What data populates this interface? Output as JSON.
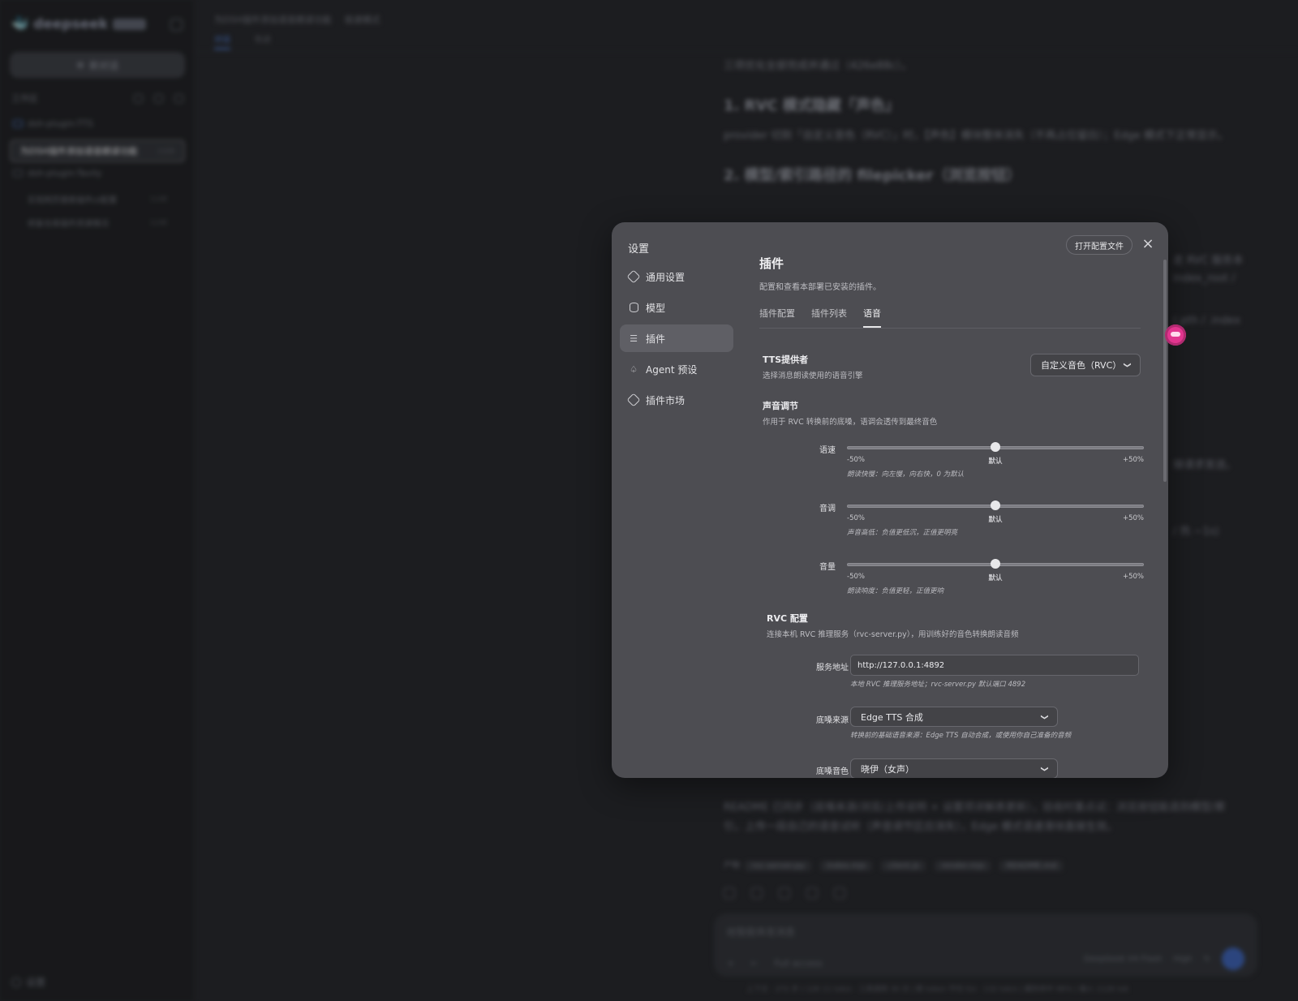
{
  "background": {
    "sidebar": {
      "brand": "deepseek",
      "new_chat": "新对话",
      "workspace_label": "工作区",
      "projects": [
        {
          "name": "dsh-plugin-TTS",
          "chats": [
            {
              "title": "为DSH插件添加语音朗读功能",
              "time": "2分钟"
            }
          ]
        },
        {
          "name": "dsh-plugin-Tavily",
          "chats": [
            {
              "title": "实现网页搜索插件UI配置",
              "time": "1小时"
            },
            {
              "title": "修复仓库插件资源情况",
              "time": "1小时"
            }
          ]
        }
      ],
      "settings": "设置"
    },
    "topbar": {
      "title": "为DSH插件添加语音朗读功能",
      "mode": "极速模式",
      "tabs": [
        "对话",
        "轨迹"
      ]
    },
    "content": {
      "intro": "三项优化全部完成并通过（426e88c）。",
      "h1": "1. RVC 模式隐藏「声色」",
      "p1": "provider 切到「自定义音色（RVC）」时，【声色】模块整体消失（不再占位留白）；Edge 模式下正常显示。",
      "h2": "2. 模型/索引路径的 filepicker（浏览按钮）",
      "frag1": "走 RVC 服务本",
      "frag2": "index_root /",
      "frag3": "(.pth / .index",
      "frag4": "接请求发送。",
      "frag5": "/ 热 ~1s)",
      "p2": "README 已同步（底嗓来源/浏览/上传说明 + 设置项详解表更新），验收时重点试：浏览按钮能选到模型/索引，上传一段自己的语音试听（声音调节区应消失），Edge 模式语速滑块直接生效。",
      "files_label": "产物",
      "files": [
        "rvc-server.py",
        "index.mjs",
        "client.js",
        "render.mjs",
        "README.md"
      ],
      "composer_placeholder": "给智能体发消息",
      "composer_access": "Full access",
      "composer_model": "DeepSeek V4 Flash",
      "composer_level": "High",
      "status": "上下文 · 272 步 | 12K 11 tok/s · 工具调用 30 次 | 默 token 平均 5/s · 132 tok/s | 缓存命中 96% | 输入 112K tok"
    }
  },
  "modal": {
    "title": "设置",
    "open_config": "打开配置文件",
    "close": "×",
    "nav": [
      {
        "label": "通用设置",
        "icon": "gear-icon"
      },
      {
        "label": "模型",
        "icon": "database-icon"
      },
      {
        "label": "插件",
        "icon": "sliders-icon"
      },
      {
        "label": "Agent 预设",
        "icon": "robot-icon"
      },
      {
        "label": "插件市场",
        "icon": "store-icon"
      }
    ],
    "active_nav": 2,
    "panel": {
      "title": "插件",
      "desc": "配置和查看本部署已安装的插件。",
      "tabs": [
        "插件配置",
        "插件列表",
        "语音"
      ],
      "active_tab": 2,
      "tts": {
        "label": "TTS提供者",
        "sub": "选择消息朗读使用的语音引擎",
        "value": "自定义音色（RVC）"
      },
      "voice": {
        "label": "声音调节",
        "sub": "作用于 RVC 转换前的底嗓，语调会透传到最终音色",
        "sliders": [
          {
            "name": "语速",
            "min": "-50%",
            "mid": "默认",
            "max": "+50%",
            "value": 0.5,
            "note": "朗读快慢：向左慢，向右快，0 为默认"
          },
          {
            "name": "音调",
            "min": "-50%",
            "mid": "默认",
            "max": "+50%",
            "value": 0.5,
            "note": "声音高低：负值更低沉，正值更明亮"
          },
          {
            "name": "音量",
            "min": "-50%",
            "mid": "默认",
            "max": "+50%",
            "value": 0.5,
            "note": "朗读响度：负值更轻，正值更响"
          }
        ]
      },
      "rvc": {
        "label": "RVC 配置",
        "sub": "连接本机 RVC 推理服务（rvc-server.py），用训练好的音色转换朗读音频",
        "server_label": "服务地址",
        "server_value": "http://127.0.0.1:4892",
        "server_note": "本地 RVC 推理服务地址；rvc-server.py 默认端口 4892",
        "source_label": "底嗓来源",
        "source_value": "Edge TTS 合成",
        "source_note": "转换前的基础语音来源：Edge TTS 自动合成，或使用你自己准备的音频",
        "voice_label": "底嗓音色",
        "voice_value": "晓伊（女声）"
      }
    }
  }
}
